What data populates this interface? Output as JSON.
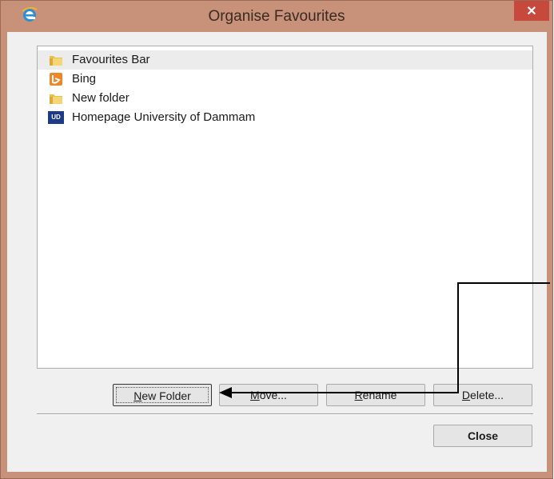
{
  "window": {
    "title": "Organise Favourites",
    "close_glyph": "✕",
    "app_icon": "internet-explorer-icon"
  },
  "favorites": [
    {
      "label": "Favourites Bar",
      "icon": "folder-icon",
      "selected": true
    },
    {
      "label": "Bing",
      "icon": "bing-icon",
      "selected": false
    },
    {
      "label": "New folder",
      "icon": "folder-icon",
      "selected": false
    },
    {
      "label": "Homepage  University of Dammam",
      "icon": "ud-site-icon",
      "icon_text": "UD",
      "selected": false
    }
  ],
  "buttons": {
    "new_folder": {
      "mnemonic": "N",
      "rest": "ew Folder"
    },
    "move": {
      "mnemonic": "M",
      "rest": "ove..."
    },
    "rename": {
      "mnemonic": "R",
      "rest": "ename"
    },
    "delete": {
      "mnemonic": "D",
      "rest": "elete..."
    },
    "close": "Close"
  },
  "colors": {
    "title_bar": "#c8927a",
    "close_button": "#c7483d",
    "client": "#f0f0f0",
    "annotation_arrow": "#000000"
  }
}
